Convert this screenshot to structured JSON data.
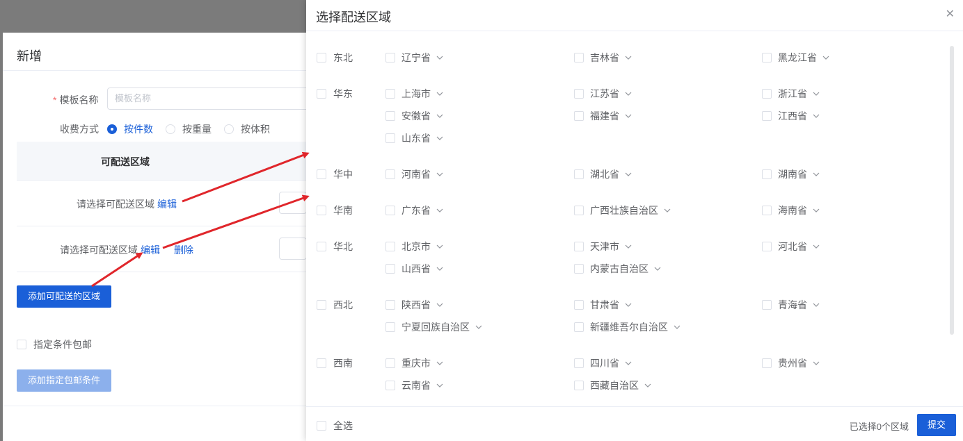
{
  "dialog": {
    "title": "新增",
    "template_name_label": "模板名称",
    "required_mark": "*",
    "template_name_placeholder": "模板名称",
    "charge_label": "收费方式",
    "charge_options": [
      "按件数",
      "按重量",
      "按体积"
    ],
    "charge_selected": "按件数",
    "table_header": "可配送区域",
    "rows": [
      {
        "text": "请选择可配送区域",
        "edit": "编辑",
        "delete": ""
      },
      {
        "text": "请选择可配送区域",
        "edit": "编辑",
        "delete": "删除"
      }
    ],
    "add_area_button": "添加可配送的区域",
    "free_shipping_label": "指定条件包邮",
    "add_condition_button": "添加指定包邮条件"
  },
  "drawer": {
    "title": "选择配送区域",
    "close_icon": "close-icon",
    "regions": [
      {
        "name": "东北",
        "provinces": [
          "辽宁省",
          "吉林省",
          "黑龙江省"
        ]
      },
      {
        "name": "华东",
        "provinces": [
          "上海市",
          "江苏省",
          "浙江省",
          "安徽省",
          "福建省",
          "江西省",
          "山东省"
        ]
      },
      {
        "name": "华中",
        "provinces": [
          "河南省",
          "湖北省",
          "湖南省"
        ]
      },
      {
        "name": "华南",
        "provinces": [
          "广东省",
          "广西壮族自治区",
          "海南省"
        ]
      },
      {
        "name": "华北",
        "provinces": [
          "北京市",
          "天津市",
          "河北省",
          "山西省",
          "内蒙古自治区"
        ]
      },
      {
        "name": "西北",
        "provinces": [
          "陕西省",
          "甘肃省",
          "青海省",
          "宁夏回族自治区",
          "新疆维吾尔自治区"
        ]
      },
      {
        "name": "西南",
        "provinces": [
          "重庆市",
          "四川省",
          "贵州省",
          "云南省",
          "西藏自治区"
        ]
      }
    ],
    "select_all_label": "全选",
    "selected_count": "已选择0个区域",
    "submit_label": "提交"
  },
  "colors": {
    "primary": "#1a5fd8",
    "annotation_arrow": "#e0262b"
  }
}
